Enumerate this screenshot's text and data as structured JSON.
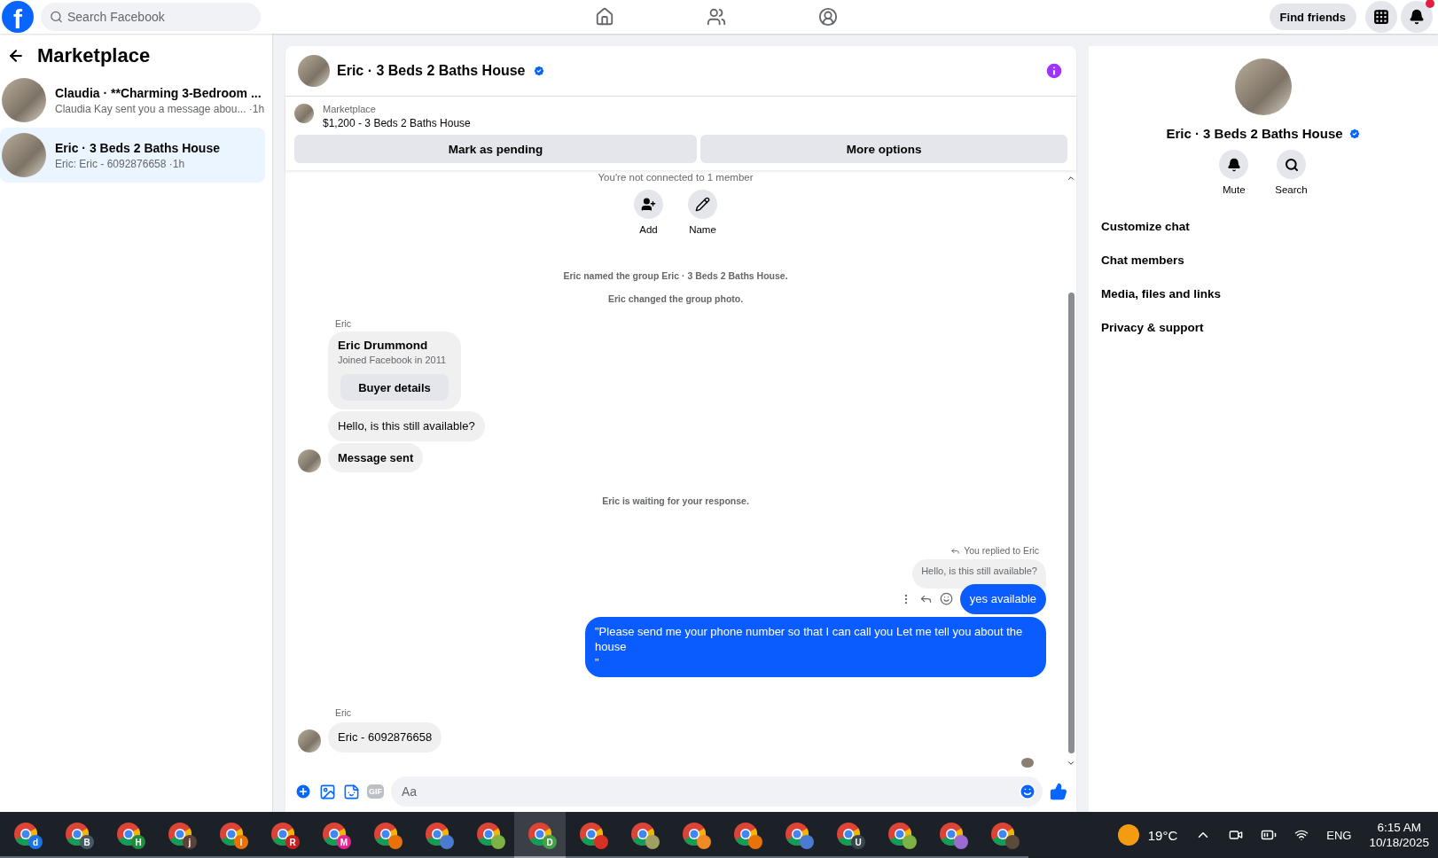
{
  "topbar": {
    "logo": "f",
    "search": {
      "placeholder": "Search Facebook"
    },
    "find_friends": "Find friends"
  },
  "sidebar": {
    "title": "Marketplace",
    "conversations": [
      {
        "title": "Claudia · **Charming 3-Bedroom ...",
        "preview": "Claudia Kay sent you a message abou...",
        "time": "·1h",
        "selected": false
      },
      {
        "title": "Eric · 3 Beds 2 Baths House",
        "preview": "Eric: Eric - 6092876658",
        "time": "·1h",
        "selected": true
      }
    ]
  },
  "chat": {
    "title": "Eric · 3 Beds 2 Baths House",
    "verified": true,
    "listing": {
      "label": "Marketplace",
      "title": "$1,200 - 3 Beds 2 Baths House"
    },
    "actions": [
      "Mark as pending",
      "More options"
    ],
    "notice": "You're not connected to 1 member",
    "group_actions": [
      {
        "label": "Add",
        "kind": "add"
      },
      {
        "label": "Name",
        "kind": "name"
      }
    ],
    "messages": [
      {
        "kind": "event",
        "text": "Eric named the group Eric · 3 Beds 2 Baths House."
      },
      {
        "kind": "event",
        "text": "Eric changed the group photo."
      },
      {
        "kind": "sender",
        "text": "Eric"
      },
      {
        "kind": "profile_card",
        "name": "Eric Drummond",
        "subtitle": "Joined Facebook in 2011",
        "button": "Buyer details"
      },
      {
        "kind": "incoming",
        "text": "Hello, is this still available?",
        "bold": false,
        "avatar": false
      },
      {
        "kind": "incoming",
        "text": "Message sent",
        "bold": true,
        "avatar": true
      },
      {
        "kind": "event",
        "text": "Eric is waiting for your response."
      },
      {
        "kind": "reply_label",
        "text": "You replied to Eric"
      },
      {
        "kind": "quoted",
        "text": "Hello, is this still available?"
      },
      {
        "kind": "outgoing",
        "text": "yes available",
        "hover_actions": true
      },
      {
        "kind": "outgoing",
        "text": "\"Please send me your phone number so that I can call you Let me tell you about the house\n\"",
        "hover_actions": false
      },
      {
        "kind": "sender",
        "text": "Eric"
      },
      {
        "kind": "incoming",
        "text": "Eric - 6092876658",
        "bold": false,
        "avatar": true
      }
    ],
    "composer": {
      "gif": "GIF",
      "placeholder": "Aa"
    }
  },
  "details": {
    "title": "Eric · 3 Beds 2 Baths House",
    "verified": true,
    "actions": [
      {
        "label": "Mute",
        "kind": "mute"
      },
      {
        "label": "Search",
        "kind": "search"
      }
    ],
    "menu": [
      "Customize chat",
      "Chat members",
      "Media, files and links",
      "Privacy & support"
    ]
  },
  "taskbar": {
    "apps": [
      {
        "letter": "d",
        "color": "#1a73e8",
        "selected": false
      },
      {
        "letter": "B",
        "color": "#455a64",
        "selected": false
      },
      {
        "letter": "H",
        "color": "#1e8e3e",
        "selected": false
      },
      {
        "letter": "j",
        "color": "#5d4037",
        "selected": false
      },
      {
        "letter": "I",
        "color": "#e8710a",
        "selected": false
      },
      {
        "letter": "R",
        "color": "#c5221f",
        "selected": false
      },
      {
        "letter": "M",
        "color": "#e52592",
        "selected": false
      },
      {
        "color": "#e8710a",
        "selected": false
      },
      {
        "color": "#4a7bd0",
        "selected": false
      },
      {
        "color": "#7cb342",
        "selected": false
      },
      {
        "letter": "D",
        "color": "#43a047",
        "selected": true
      },
      {
        "color": "#d93025",
        "selected": false
      },
      {
        "color": "#a0a060",
        "selected": false
      },
      {
        "color": "#f08a24",
        "selected": false
      },
      {
        "color": "#e8710a",
        "selected": false
      },
      {
        "color": "#4a7bd0",
        "selected": false
      },
      {
        "letter": "U",
        "color": "#37474f",
        "selected": false
      },
      {
        "color": "#7cb342",
        "selected": false
      },
      {
        "color": "#9c6ad0",
        "selected": false
      },
      {
        "color": "#5a4a3a",
        "selected": false
      }
    ],
    "weather": "19°C",
    "language": "ENG",
    "time": "6:15 AM",
    "date": "10/18/2025"
  }
}
